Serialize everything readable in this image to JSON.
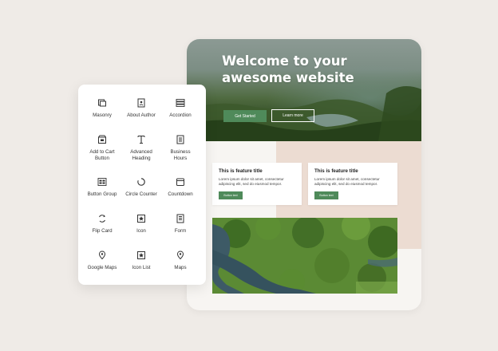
{
  "hero": {
    "title": "Welcome to your awesome website",
    "primary_button": "Get Started",
    "secondary_button": "Learn more"
  },
  "features": [
    {
      "title": "This is feature title",
      "description": "Lorem ipsum dolor sit amet, consectetur adipiscing elit, sed do eiusmod tempor.",
      "button": "Button text"
    },
    {
      "title": "This is feature title",
      "description": "Lorem ipsum dolor sit amet, consectetur adipiscing elit, sed do eiusmod tempor.",
      "button": "Button text"
    }
  ],
  "widgets": [
    {
      "label": "Masonry",
      "icon": "masonry-icon"
    },
    {
      "label": "About Author",
      "icon": "about-author-icon"
    },
    {
      "label": "Accordion",
      "icon": "accordion-icon"
    },
    {
      "label": "Add to Cart\nButton",
      "icon": "add-to-cart-icon"
    },
    {
      "label": "Advanced\nHeading",
      "icon": "advanced-heading-icon"
    },
    {
      "label": "Business\nHours",
      "icon": "business-hours-icon"
    },
    {
      "label": "Button Group",
      "icon": "button-group-icon"
    },
    {
      "label": "Circle Counter",
      "icon": "circle-counter-icon"
    },
    {
      "label": "Countdown",
      "icon": "countdown-icon"
    },
    {
      "label": "Flip Card",
      "icon": "flip-card-icon"
    },
    {
      "label": "Icon",
      "icon": "icon-widget-icon"
    },
    {
      "label": "Form",
      "icon": "form-icon"
    },
    {
      "label": "Google Maps",
      "icon": "google-maps-icon"
    },
    {
      "label": "Icon List",
      "icon": "icon-list-icon"
    },
    {
      "label": "Maps",
      "icon": "maps-icon"
    }
  ],
  "colors": {
    "background": "#efebe7",
    "accent_green": "#4f8a5a",
    "pink_block": "#ecdcd2",
    "card": "#f7f5f2"
  }
}
